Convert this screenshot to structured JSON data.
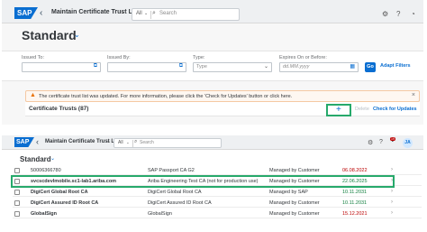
{
  "panel1": {
    "shell": {
      "logo": "SAP",
      "title": "Maintain Certificate Trust L...",
      "search_scope": "All",
      "search_placeholder": "Search"
    },
    "variant": "Standard",
    "filters": [
      {
        "label": "Issued To:",
        "placeholder": ""
      },
      {
        "label": "Issued By:",
        "placeholder": ""
      },
      {
        "label": "Type:",
        "placeholder": "Type"
      },
      {
        "label": "Expires On or Before:",
        "placeholder": "dd.MM.yyyy"
      }
    ],
    "go_label": "Go",
    "adapt_label": "Adapt Filters",
    "message": "The certificate trust list was updated. For more information, please click the 'Check for Updates' button or click here.",
    "table": {
      "title": "Certificate Trusts (87)",
      "add_label": "+",
      "delete_label": "Delete",
      "check_label": "Check for Updates"
    }
  },
  "panel2": {
    "shell": {
      "logo": "SAP",
      "title": "Maintain Certificate Trust L...",
      "search_scope": "All",
      "search_placeholder": "Search",
      "notification_count": "19",
      "avatar": "JA"
    },
    "variant": "Standard",
    "rows": [
      {
        "name": "50006366780",
        "issuer": "SAP Passport CA G2",
        "type": "Managed by Customer",
        "date": "06.08.2022",
        "expired": true
      },
      {
        "name": "svcscdevlmobile.sc1-lab1.ariba.com",
        "issuer": "Ariba Engineering Test CA (not for production use)",
        "type": "Managed by Customer",
        "date": "22.06.2025",
        "expired": false
      },
      {
        "name": "DigiCert Global Root CA",
        "issuer": "DigiCert Global Root CA",
        "type": "Managed by SAP",
        "date": "10.11.2031",
        "expired": false
      },
      {
        "name": "DigiCert Assured ID Root CA",
        "issuer": "DigiCert Assured ID Root CA",
        "type": "Managed by Customer",
        "date": "10.11.2031",
        "expired": false
      },
      {
        "name": "GlobalSign",
        "issuer": "GlobalSign",
        "type": "Managed by Customer",
        "date": "15.12.2021",
        "expired": true
      }
    ]
  },
  "colors": {
    "brand": "#0a6ed1",
    "highlight": "#27a96b",
    "warning": "#e9730c",
    "valid": "#107e3e",
    "expired": "#bb0000"
  }
}
